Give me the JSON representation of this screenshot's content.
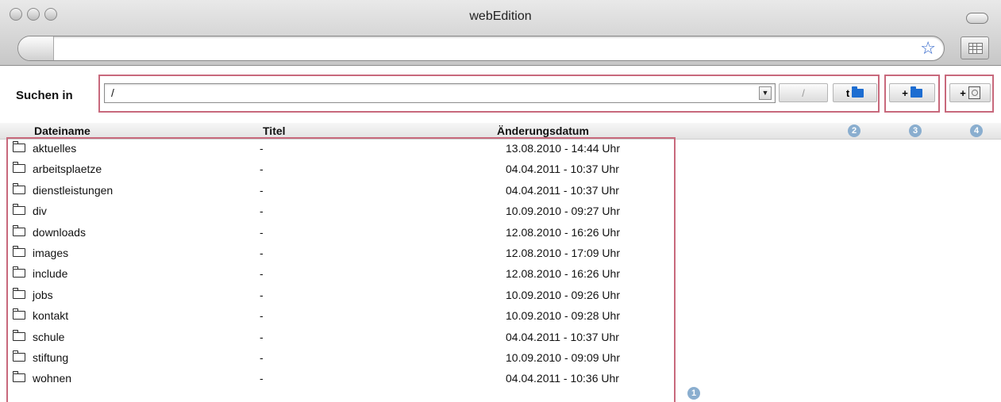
{
  "window": {
    "title": "webEdition"
  },
  "address": {
    "value": ""
  },
  "toolbar": {
    "search_label": "Suchen in",
    "path_value": "/",
    "root_button_label": "/",
    "up_button_label": "t"
  },
  "columns": {
    "name": "Dateiname",
    "title": "Titel",
    "date": "Änderungsdatum"
  },
  "callouts": {
    "list": "1",
    "navigate": "2",
    "new_folder": "3",
    "new_file": "4"
  },
  "files": [
    {
      "name": "aktuelles",
      "title": "-",
      "date": "13.08.2010 - 14:44 Uhr"
    },
    {
      "name": "arbeitsplaetze",
      "title": "-",
      "date": "04.04.2011 - 10:37 Uhr"
    },
    {
      "name": "dienstleistungen",
      "title": "-",
      "date": "04.04.2011 - 10:37 Uhr"
    },
    {
      "name": "div",
      "title": "-",
      "date": "10.09.2010 - 09:27 Uhr"
    },
    {
      "name": "downloads",
      "title": "-",
      "date": "12.08.2010 - 16:26 Uhr"
    },
    {
      "name": "images",
      "title": "-",
      "date": "12.08.2010 - 17:09 Uhr"
    },
    {
      "name": "include",
      "title": "-",
      "date": "12.08.2010 - 16:26 Uhr"
    },
    {
      "name": "jobs",
      "title": "-",
      "date": "10.09.2010 - 09:26 Uhr"
    },
    {
      "name": "kontakt",
      "title": "-",
      "date": "10.09.2010 - 09:28 Uhr"
    },
    {
      "name": "schule",
      "title": "-",
      "date": "04.04.2011 - 10:37 Uhr"
    },
    {
      "name": "stiftung",
      "title": "-",
      "date": "10.09.2010 - 09:09 Uhr"
    },
    {
      "name": "wohnen",
      "title": "-",
      "date": "04.04.2011 - 10:36 Uhr"
    }
  ],
  "colors": {
    "highlight": "#c8697c",
    "badge": "#8aaecf",
    "folder_accent": "#1d6dd1"
  }
}
